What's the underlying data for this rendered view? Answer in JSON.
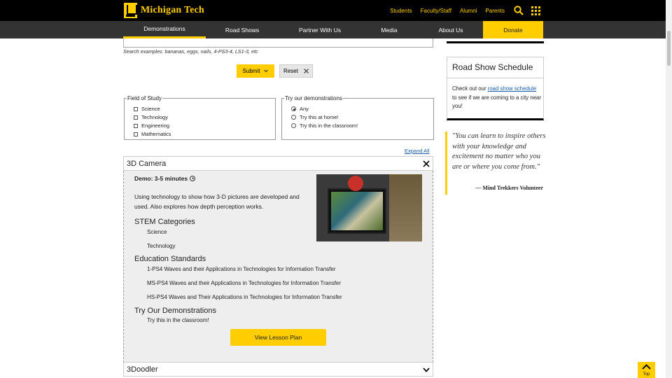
{
  "header": {
    "logo_text": "Michigan Tech",
    "links": [
      "Students",
      "Faculty/Staff",
      "Alumni",
      "Parents"
    ],
    "search_icon": "search-icon",
    "apps_icon": "grid-icon"
  },
  "nav": {
    "items": [
      "Demonstrations",
      "Road Shows",
      "Partner With Us",
      "Media",
      "About Us",
      "Donate"
    ],
    "active": "Demonstrations"
  },
  "search": {
    "examples": "Search examples: bananas, eggs, nails, 4-PS3-4, LS1-3, etc",
    "submit_label": "Submit",
    "reset_label": "Reset"
  },
  "filters": {
    "field_legend": "Field of Study",
    "fields": [
      "Science",
      "Technology",
      "Engineering",
      "Mathematics"
    ],
    "demo_legend": "Try our demonstrations",
    "demo_options": [
      "Any",
      "Try this at home!",
      "Try this in the classroom!"
    ],
    "demo_selected": "Any"
  },
  "expand_all_label": "Expand All",
  "demos": [
    {
      "title": "3D Camera",
      "expanded": true,
      "duration": "Demo: 3-5 minutes",
      "description": "Using technology to show how 3-D pictures are developed and used. Also explores how depth perception works.",
      "stem_heading": "STEM Categories",
      "stem": [
        "Science",
        "Technology"
      ],
      "standards_heading": "Education Standards",
      "standards": [
        "1-PS4 Waves and their Applications in Technologies for Information Transfer",
        "MS-PS4 Waves and their Applications in Technologies for Information Transfer",
        "HS-PS4 Waves and Their Applications in Technologies for Information Transfer"
      ],
      "try_heading": "Try Our Demonstrations",
      "try": [
        "Try this in the classroom!"
      ],
      "lesson_button": "View Lesson Plan"
    },
    {
      "title": "3Doodler",
      "expanded": false
    }
  ],
  "sidebar": {
    "road_show_title": "Road Show Schedule",
    "road_show_text_before": "Check out our",
    "road_show_link": "road show schedule",
    "road_show_text_after": "to see if we are coming to a city near you!",
    "quote": "\"You can learn to inspire others with your knowledge and excitement no matter who you are or where you come from.\"",
    "quote_attribution": "— Mind Trekkers Volunteer"
  },
  "top_button_label": "Top",
  "colors": {
    "brand_gold": "#ffcd00",
    "header_black": "#000000",
    "nav_gray": "#333333",
    "link_blue": "#1a5ea8"
  }
}
